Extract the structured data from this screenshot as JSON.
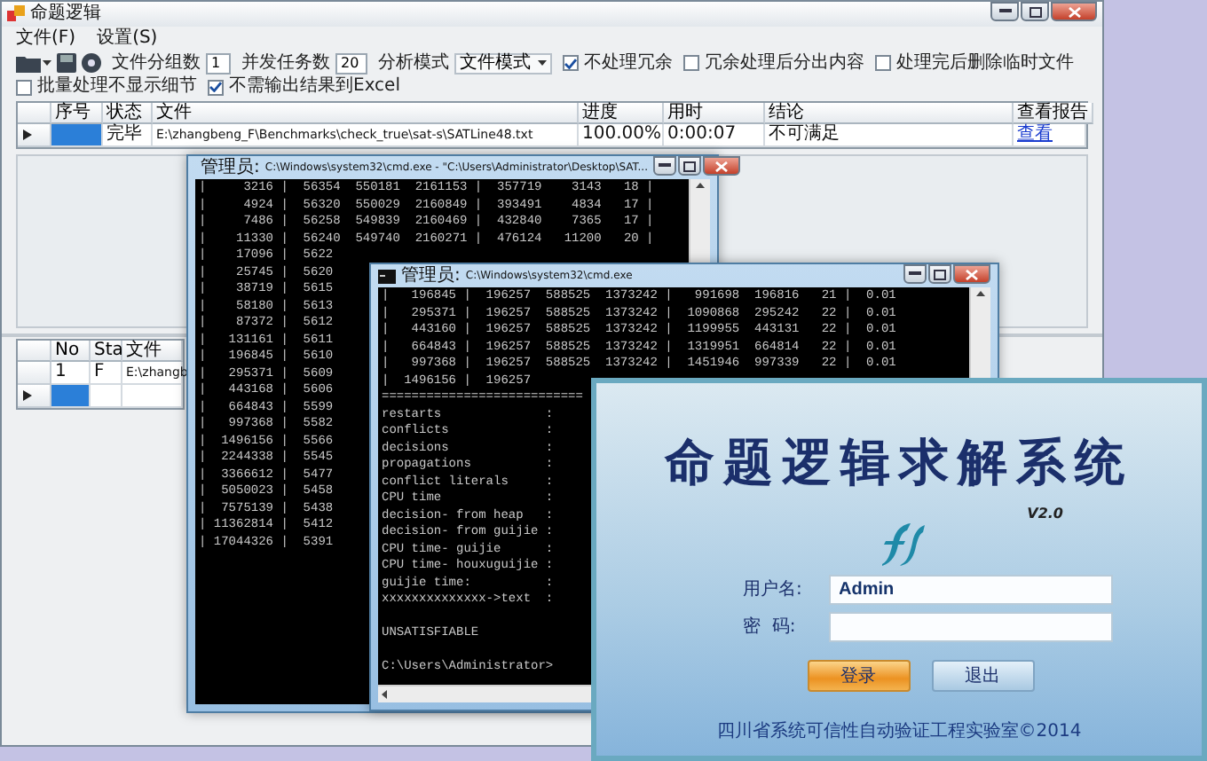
{
  "main_window": {
    "title": "命题逻辑",
    "menu": [
      "文件(F)",
      "设置(S)"
    ],
    "toolbar": {
      "groups_label": "文件分组数",
      "groups_value": "1",
      "tasks_label": "并发任务数",
      "tasks_value": "20",
      "mode_label": "分析模式",
      "mode_value": "文件模式",
      "checkboxes": [
        {
          "label": "不处理冗余",
          "checked": true
        },
        {
          "label": "冗余处理后分出内容",
          "checked": false
        },
        {
          "label": "处理完后删除临时文件",
          "checked": false
        },
        {
          "label": "批量处理不显示细节",
          "checked": false
        },
        {
          "label": "不需输出结果到Excel",
          "checked": true
        }
      ]
    },
    "upper_grid": {
      "columns": [
        "序号",
        "状态",
        "文件",
        "进度",
        "用时",
        "结论",
        "查看报告"
      ],
      "rows": [
        {
          "current": true,
          "cells": [
            {
              "selected": true
            },
            {
              "text": "完毕",
              "selected": false
            },
            {
              "text": "E:\\zhangbeng_F\\Benchmarks\\check_true\\sat-s\\SATLine48.txt",
              "selected": false
            },
            {
              "text": "100.00%",
              "selected": false
            },
            {
              "text": "0:00:07",
              "selected": false
            },
            {
              "text": "不可满足",
              "selected": false
            },
            {
              "text": "查看",
              "selected": false,
              "kind": "link"
            }
          ]
        }
      ]
    },
    "lower_grid": {
      "columns": [
        "No",
        "Sta",
        "文件"
      ],
      "rows": [
        {
          "current": false,
          "cells": [
            {
              "text": "1",
              "selected": false
            },
            {
              "text": "F",
              "selected": false
            },
            {
              "text": "E:\\zhangb",
              "selected": false
            }
          ]
        },
        {
          "current": true,
          "cells": [
            {
              "selected": true
            },
            {
              "selected": false
            },
            {
              "selected": false
            }
          ]
        }
      ]
    }
  },
  "console_back": {
    "owner": "管理员:",
    "path": "C:\\Windows\\system32\\cmd.exe - \"C:\\Users\\Administrator\\Desktop\\SAT...",
    "lines": [
      "|     3216 |  56354  550181  2161153 |  357719    3143   18 |",
      "|     4924 |  56320  550029  2160849 |  393491    4834   17 |",
      "|     7486 |  56258  549839  2160469 |  432840    7365   17 |",
      "|    11330 |  56240  549740  2160271 |  476124   11200   20 |",
      "|    17096 |  5622",
      "|    25745 |  5620",
      "|    38719 |  5615",
      "|    58180 |  5613",
      "|    87372 |  5612",
      "|   131161 |  5611",
      "|   196845 |  5610",
      "|   295371 |  5609",
      "|   443168 |  5606",
      "|   664843 |  5599",
      "|   997368 |  5582",
      "|  1496156 |  5566",
      "|  2244338 |  5545",
      "|  3366612 |  5477",
      "|  5050023 |  5458",
      "|  7575139 |  5438",
      "| 11362814 |  5412",
      "| 17044326 |  5391"
    ]
  },
  "console_front": {
    "owner": "管理员:",
    "path": "C:\\Windows\\system32\\cmd.exe",
    "rows": [
      "|   196845 |  196257  588525  1373242 |   991698  196816   21 |  0.01",
      "|   295371 |  196257  588525  1373242 |  1090868  295242   22 |  0.01",
      "|   443160 |  196257  588525  1373242 |  1199955  443131   22 |  0.01",
      "|   664843 |  196257  588525  1373242 |  1319951  664814   22 |  0.01",
      "|   997368 |  196257  588525  1373242 |  1451946  997339   22 |  0.01",
      "|  1496156 |  196257"
    ],
    "separator": "===========================",
    "stats": [
      "restarts              :",
      "conflicts             :",
      "decisions             :",
      "propagations          :",
      "conflict literals     :",
      "CPU time              :",
      "decision- from heap   :",
      "decision- from guijie :",
      "CPU time- guijie      :",
      "CPU time- houxuguijie :",
      "guijie time:          :",
      "xxxxxxxxxxxxxx->text  :"
    ],
    "result": "UNSATISFIABLE",
    "prompt": "C:\\Users\\Administrator>"
  },
  "login": {
    "title": "命题逻辑求解系统",
    "version": "V2.0",
    "username_label": "用户名:",
    "username_value": "Admin",
    "password_label": "密  码:",
    "buttons": [
      {
        "label": "登录",
        "kind": "primary"
      },
      {
        "label": "退出",
        "kind": "secondary"
      }
    ],
    "footer": "四川省系统可信性自动验证工程实验室©2014"
  }
}
